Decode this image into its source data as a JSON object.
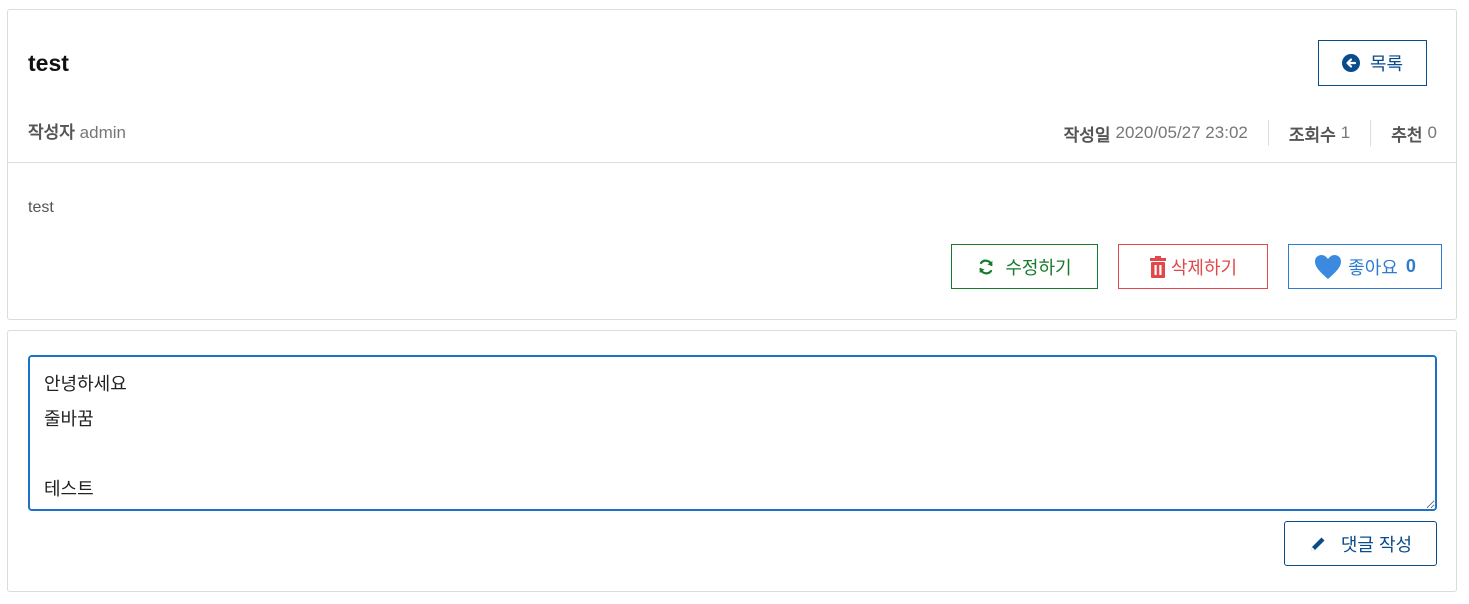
{
  "post": {
    "title": "test",
    "list_button": "목록",
    "author_label": "작성자",
    "author": "admin",
    "date_label": "작성일",
    "date": "2020/05/27 23:02",
    "views_label": "조회수",
    "views": "1",
    "recommend_label": "추천",
    "recommend": "0",
    "body": "test",
    "edit_button": "수정하기",
    "delete_button": "삭제하기",
    "like_button": "좋아요",
    "like_count": "0"
  },
  "comment": {
    "value": "안녕하세요\n줄바꿈\n\n테스트",
    "submit_button": "댓글 작성"
  },
  "colors": {
    "primary": "#0a4b8c",
    "edit": "#167a2a",
    "delete": "#e0484a",
    "like": "#2d7ccf",
    "focus": "#1a73c8"
  },
  "icons": {
    "list": "arrow-circle-left-icon",
    "edit": "refresh-icon",
    "delete": "trash-icon",
    "like": "heart-icon",
    "submit": "pencil-icon"
  }
}
